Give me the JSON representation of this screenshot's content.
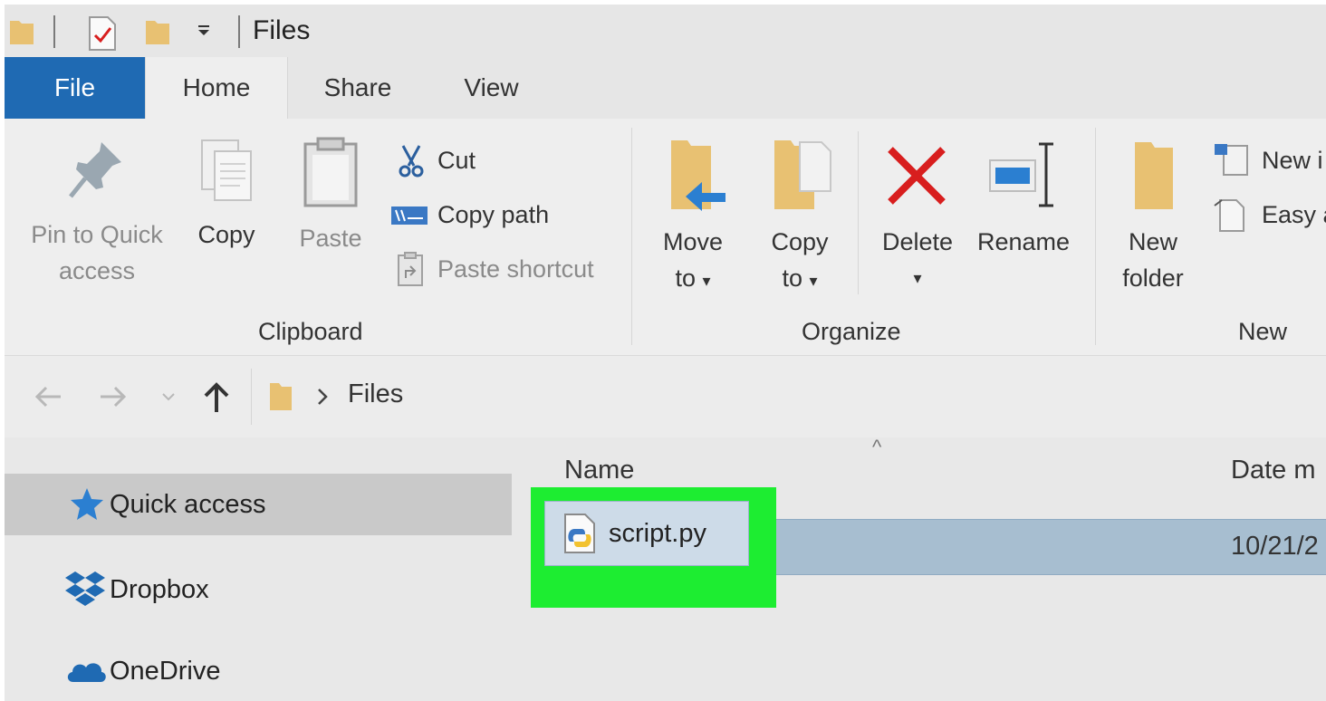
{
  "window": {
    "title": "Files"
  },
  "tabs": {
    "file": "File",
    "home": "Home",
    "share": "Share",
    "view": "View"
  },
  "ribbon": {
    "clipboard": {
      "label": "Clipboard",
      "pin_line1": "Pin to Quick",
      "pin_line2": "access",
      "copy": "Copy",
      "paste": "Paste",
      "cut": "Cut",
      "copy_path": "Copy path",
      "paste_shortcut": "Paste shortcut"
    },
    "organize": {
      "label": "Organize",
      "move_line1": "Move",
      "move_line2": "to",
      "copy_line1": "Copy",
      "copy_line2": "to",
      "delete": "Delete",
      "rename": "Rename"
    },
    "new": {
      "label": "New",
      "folder_line1": "New",
      "folder_line2": "folder",
      "new_item": "New i",
      "easy_access": "Easy a"
    }
  },
  "address": {
    "crumb": "Files"
  },
  "nav": {
    "quick_access": "Quick access",
    "dropbox": "Dropbox",
    "onedrive": "OneDrive"
  },
  "list": {
    "columns": {
      "name": "Name",
      "date": "Date m"
    },
    "rows": [
      {
        "name": "script.py",
        "date": "10/21/2"
      }
    ]
  },
  "colors": {
    "file_tab": "#1f6ab3",
    "selection": "#a7bed0",
    "highlight": "#1ded31",
    "delete_x": "#d81e1e",
    "folder": "#e8c172",
    "arrow_blue": "#2b7fd1"
  }
}
